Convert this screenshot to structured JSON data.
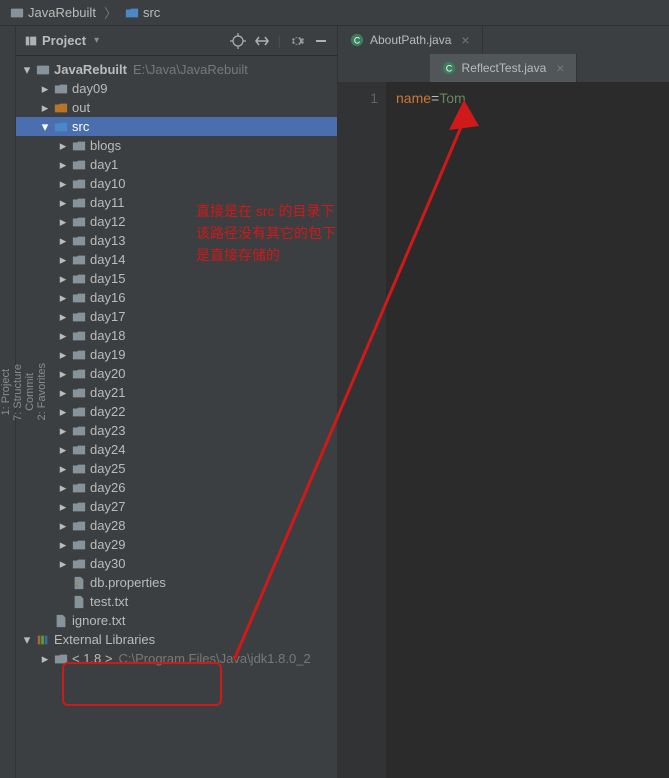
{
  "breadcrumb": {
    "root": "JavaRebuilt",
    "child": "src"
  },
  "sidebar_gutter": {
    "project": "1: Project",
    "structure": "7: Structure",
    "commit": "Commit",
    "favorites": "2: Favorites"
  },
  "project_panel": {
    "title": "Project"
  },
  "tree": {
    "root": {
      "label": "JavaRebuilt",
      "path": "E:\\Java\\JavaRebuilt"
    },
    "children": [
      {
        "label": "day09",
        "indent": 1,
        "icon": "folder",
        "arrow": "right"
      },
      {
        "label": "out",
        "indent": 1,
        "icon": "folder-orange",
        "arrow": "right"
      },
      {
        "label": "src",
        "indent": 1,
        "icon": "folder-blue",
        "arrow": "down",
        "selected": true
      },
      {
        "label": "blogs",
        "indent": 2,
        "icon": "folder",
        "arrow": "right"
      },
      {
        "label": "day1",
        "indent": 2,
        "icon": "folder",
        "arrow": "right"
      },
      {
        "label": "day10",
        "indent": 2,
        "icon": "folder",
        "arrow": "right"
      },
      {
        "label": "day11",
        "indent": 2,
        "icon": "folder",
        "arrow": "right"
      },
      {
        "label": "day12",
        "indent": 2,
        "icon": "folder",
        "arrow": "right"
      },
      {
        "label": "day13",
        "indent": 2,
        "icon": "folder",
        "arrow": "right"
      },
      {
        "label": "day14",
        "indent": 2,
        "icon": "folder",
        "arrow": "right"
      },
      {
        "label": "day15",
        "indent": 2,
        "icon": "folder",
        "arrow": "right"
      },
      {
        "label": "day16",
        "indent": 2,
        "icon": "folder",
        "arrow": "right"
      },
      {
        "label": "day17",
        "indent": 2,
        "icon": "folder",
        "arrow": "right"
      },
      {
        "label": "day18",
        "indent": 2,
        "icon": "folder",
        "arrow": "right"
      },
      {
        "label": "day19",
        "indent": 2,
        "icon": "folder",
        "arrow": "right"
      },
      {
        "label": "day20",
        "indent": 2,
        "icon": "folder",
        "arrow": "right"
      },
      {
        "label": "day21",
        "indent": 2,
        "icon": "folder",
        "arrow": "right"
      },
      {
        "label": "day22",
        "indent": 2,
        "icon": "folder",
        "arrow": "right"
      },
      {
        "label": "day23",
        "indent": 2,
        "icon": "folder",
        "arrow": "right"
      },
      {
        "label": "day24",
        "indent": 2,
        "icon": "folder",
        "arrow": "right"
      },
      {
        "label": "day25",
        "indent": 2,
        "icon": "folder",
        "arrow": "right"
      },
      {
        "label": "day26",
        "indent": 2,
        "icon": "folder",
        "arrow": "right"
      },
      {
        "label": "day27",
        "indent": 2,
        "icon": "folder",
        "arrow": "right"
      },
      {
        "label": "day28",
        "indent": 2,
        "icon": "folder",
        "arrow": "right"
      },
      {
        "label": "day29",
        "indent": 2,
        "icon": "folder",
        "arrow": "right"
      },
      {
        "label": "day30",
        "indent": 2,
        "icon": "folder",
        "arrow": "right"
      },
      {
        "label": "db.properties",
        "indent": 2,
        "icon": "file-props",
        "arrow": "none"
      },
      {
        "label": "test.txt",
        "indent": 2,
        "icon": "file",
        "arrow": "none"
      },
      {
        "label": "ignore.txt",
        "indent": 1,
        "icon": "file",
        "arrow": "none"
      }
    ],
    "external": {
      "label": "External Libraries"
    },
    "jdk": {
      "label": "< 1.8 >",
      "path": "C:\\Program Files\\Java\\jdk1.8.0_2"
    }
  },
  "editor": {
    "tab1": "AboutPath.java",
    "tab2": "ReflectTest.java",
    "line_number": "1",
    "code_key": "name",
    "code_eq": "=",
    "code_val": "Tom"
  },
  "annotation": {
    "line1": "直接是在 src 的目录下",
    "line2": "该路径没有其它的包下",
    "line3": "是直接存储的"
  }
}
